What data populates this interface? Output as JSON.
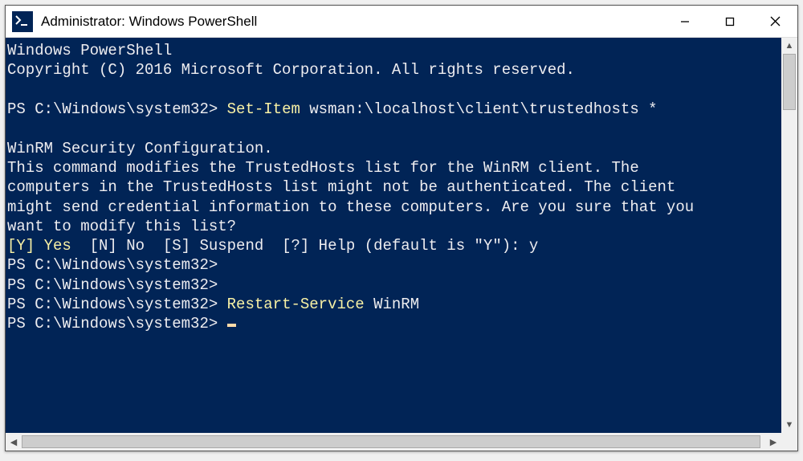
{
  "window": {
    "title": "Administrator: Windows PowerShell",
    "icon_glyph": ">_"
  },
  "controls": {
    "minimize_label": "—",
    "maximize_label": "☐",
    "close_label": "✕"
  },
  "terminal": {
    "header1": "Windows PowerShell",
    "header2": "Copyright (C) 2016 Microsoft Corporation. All rights reserved.",
    "prompt": "PS C:\\Windows\\system32>",
    "cmd1_name": "Set-Item",
    "cmd1_args": " wsman:\\localhost\\client\\trustedhosts *",
    "warn_title": "WinRM Security Configuration.",
    "warn_body1": "This command modifies the TrustedHosts list for the WinRM client. The",
    "warn_body2": "computers in the TrustedHosts list might not be authenticated. The client",
    "warn_body3": "might send credential information to these computers. Are you sure that you",
    "warn_body4": "want to modify this list?",
    "choice_y_key": "[Y] ",
    "choice_y_label": "Yes",
    "choice_rest": "  [N] No  [S] Suspend  [?] Help (default is \"Y\"): ",
    "choice_input": "y",
    "cmd2_name": "Restart-Service",
    "cmd2_args": " WinRM"
  },
  "scrollbar": {
    "up": "▲",
    "down": "▼",
    "left": "◀",
    "right": "▶"
  }
}
